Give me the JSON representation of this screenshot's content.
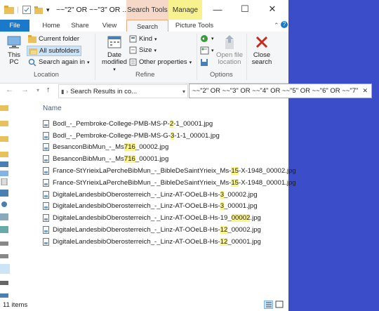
{
  "window": {
    "title": "~~\"2\" OR ~~\"3\" OR ...",
    "context_tabs": {
      "search_tools": "Search Tools",
      "manage": "Manage"
    },
    "controls": {
      "minimize": "—",
      "maximize": "☐",
      "close": "✕"
    }
  },
  "tabs": [
    "File",
    "Home",
    "Share",
    "View",
    "Search",
    "Picture Tools"
  ],
  "ribbon": {
    "location": {
      "this_pc": "This PC",
      "current_folder": "Current folder",
      "all_subfolders": "All subfolders",
      "search_again_in": "Search again in",
      "label": "Location"
    },
    "refine": {
      "date_modified_line1": "Date",
      "date_modified_line2": "modified",
      "kind": "Kind",
      "size": "Size",
      "other_properties": "Other properties",
      "label": "Refine"
    },
    "options": {
      "open_file_location_line1": "Open file",
      "open_file_location_line2": "location",
      "label": "Options"
    },
    "close_search_line1": "Close",
    "close_search_line2": "search"
  },
  "address": {
    "path": "Search Results in co...",
    "search_query": "~~\"2\" OR ~~\"3\" OR ~~\"4\" OR ~~\"5\" OR ~~\"6\" OR ~~\"7\"",
    "clear": "✕"
  },
  "list": {
    "column_name": "Name",
    "files": [
      {
        "pre": "Bodl_-_Pembroke-College-PMB-MS-P-",
        "hl": "2",
        "post": "-1_00001.jpg"
      },
      {
        "pre": "Bodl_-_Pembroke-College-PMB-MS-G-",
        "hl": "3",
        "post": "-1-1_00001.jpg"
      },
      {
        "pre": "BesanconBibMun_-_Ms",
        "hl": "716",
        "post": "_00002.jpg"
      },
      {
        "pre": "BesanconBibMun_-_Ms",
        "hl": "716",
        "post": "_00001.jpg"
      },
      {
        "pre": "France-StYrieixLaPercheBibMun_-_BibleDeSaintYrieix_Ms-",
        "hl": "15",
        "post": "-X-1948_00002.jpg"
      },
      {
        "pre": "France-StYrieixLaPercheBibMun_-_BibleDeSaintYrieix_Ms-",
        "hl": "15",
        "post": "-X-1948_00001.jpg"
      },
      {
        "pre": "DigitaleLandesbibOberosterreich_-_Linz-AT-OOeLB-Hs-",
        "hl": "3",
        "post": "_00002.jpg"
      },
      {
        "pre": "DigitaleLandesbibOberosterreich_-_Linz-AT-OOeLB-Hs-",
        "hl": "3",
        "post": "_00001.jpg"
      },
      {
        "pre": "DigitaleLandesbibOberosterreich_-_Linz-AT-OOeLB-Hs-19_",
        "hl": "00002",
        "post": ".jpg"
      },
      {
        "pre": "DigitaleLandesbibOberosterreich_-_Linz-AT-OOeLB-Hs-",
        "hl": "12",
        "post": "_00002.jpg"
      },
      {
        "pre": "DigitaleLandesbibOberosterreich_-_Linz-AT-OOeLB-Hs-",
        "hl": "12",
        "post": "_00001.jpg"
      }
    ]
  },
  "status": {
    "item_count": "11 items"
  },
  "colors": {
    "file_tab": "#1979ca",
    "search_tools": "#f5d8c8",
    "manage": "#f8f28e",
    "highlight": "#faf38a",
    "desktop": "#3b4dc8",
    "close_x": "#c42b1c"
  }
}
